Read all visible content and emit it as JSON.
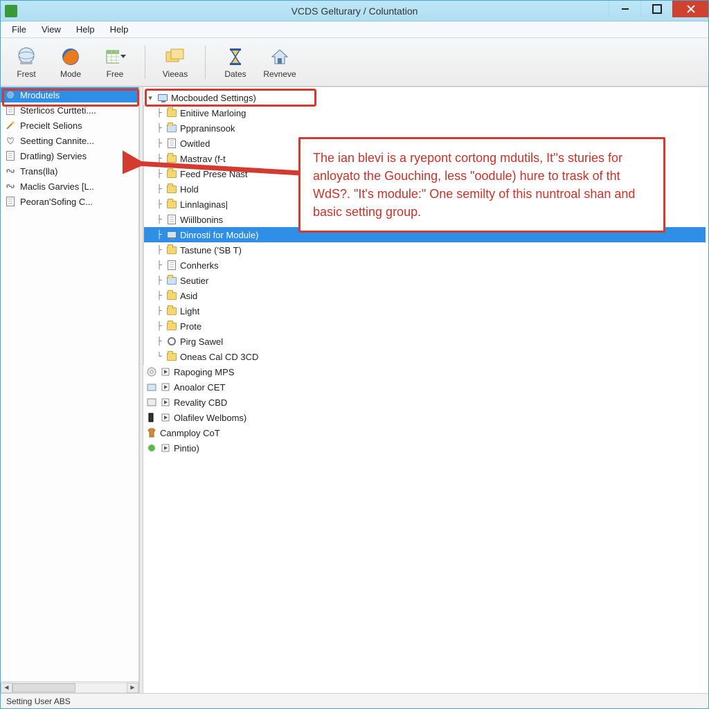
{
  "window": {
    "title": "VCDS Gelturary / Coluntation"
  },
  "menu": {
    "items": [
      "File",
      "View",
      "Help",
      "Help"
    ]
  },
  "toolbar": {
    "groups": [
      {
        "buttons": [
          {
            "id": "frest",
            "label": "Frest",
            "icon": "globe-blue"
          },
          {
            "id": "mode",
            "label": "Mode",
            "icon": "firefox"
          },
          {
            "id": "free",
            "label": "Free",
            "icon": "spreadsheet",
            "dropdown": true
          }
        ]
      },
      {
        "buttons": [
          {
            "id": "vieeas",
            "label": "Vieeas",
            "icon": "folders"
          }
        ]
      },
      {
        "buttons": [
          {
            "id": "dates",
            "label": "Dates",
            "icon": "hourglass"
          },
          {
            "id": "revneve",
            "label": "Revneve",
            "icon": "home"
          }
        ]
      }
    ]
  },
  "sidebar": {
    "items": [
      {
        "label": "Mrodutels",
        "icon": "globe",
        "selected": true
      },
      {
        "label": "Sterlicos Curtteti....",
        "icon": "page"
      },
      {
        "label": "Precielt Selions",
        "icon": "wand"
      },
      {
        "label": "Seetting Cannite...",
        "icon": "heart"
      },
      {
        "label": "Dratling) Servies",
        "icon": "page"
      },
      {
        "label": "Trans(lla)",
        "icon": "link"
      },
      {
        "label": "Maclis Garvies [L..",
        "icon": "link"
      },
      {
        "label": "Peoran'Sofing C...",
        "icon": "page"
      }
    ]
  },
  "tree": {
    "root": {
      "label": "Mocbouded Settings)",
      "icon": "monitor",
      "expanded": true,
      "highlight": true,
      "children": [
        {
          "label": "Enitiive Marloing",
          "icon": "folder"
        },
        {
          "label": "Pppraninsook",
          "icon": "folder-blue"
        },
        {
          "label": "Owitled",
          "icon": "page"
        },
        {
          "label": "Mastrav (f-t",
          "icon": "folder",
          "obscured": true
        },
        {
          "label": "Feed Prese Nast",
          "icon": "folder"
        },
        {
          "label": "Hold",
          "icon": "folder"
        },
        {
          "label": "Linnlaginas|",
          "icon": "folder"
        },
        {
          "label": "Wiillbonins",
          "icon": "page"
        },
        {
          "label": "Dinrosti for Module)",
          "icon": "monitor",
          "selected": true
        },
        {
          "label": "Tastune ('SB T)",
          "icon": "folder"
        },
        {
          "label": "Conherks",
          "icon": "page"
        },
        {
          "label": "Seutier",
          "icon": "folder-blue"
        },
        {
          "label": "Asid",
          "icon": "folder"
        },
        {
          "label": "Light",
          "icon": "folder"
        },
        {
          "label": "Prote",
          "icon": "folder"
        },
        {
          "label": "Pirg Sawel",
          "icon": "gear"
        },
        {
          "label": "Oneas Cal CD 3CD",
          "icon": "folder",
          "lastGroup": true
        }
      ],
      "after": [
        {
          "label": "Rapoging MPS",
          "icon": "disc",
          "play": true
        },
        {
          "label": "Anoalor CET",
          "icon": "box",
          "play": true
        },
        {
          "label": "Revality CBD",
          "icon": "box",
          "play": true
        },
        {
          "label": "Olafilev Welboms)",
          "icon": "device",
          "play": true
        },
        {
          "label": "Canmploy CoT",
          "icon": "shirt"
        },
        {
          "label": "Pintio)",
          "icon": "green",
          "play": true
        }
      ]
    }
  },
  "callout": {
    "text": "The ian blevi is a ryepont cortong mdutils, It''s sturies for anloyato the Gouching, less \"oodule) hure to trask of tht WdS?. \"It's module:\" One semilty of this nuntroal shan and basic setting group."
  },
  "statusbar": {
    "text": "Setting User ABS"
  },
  "colors": {
    "selection": "#2f8ee6",
    "highlight_border": "#d43a2f",
    "titlebar_bg": "#b4e2f3",
    "close_btn": "#d0412e"
  }
}
